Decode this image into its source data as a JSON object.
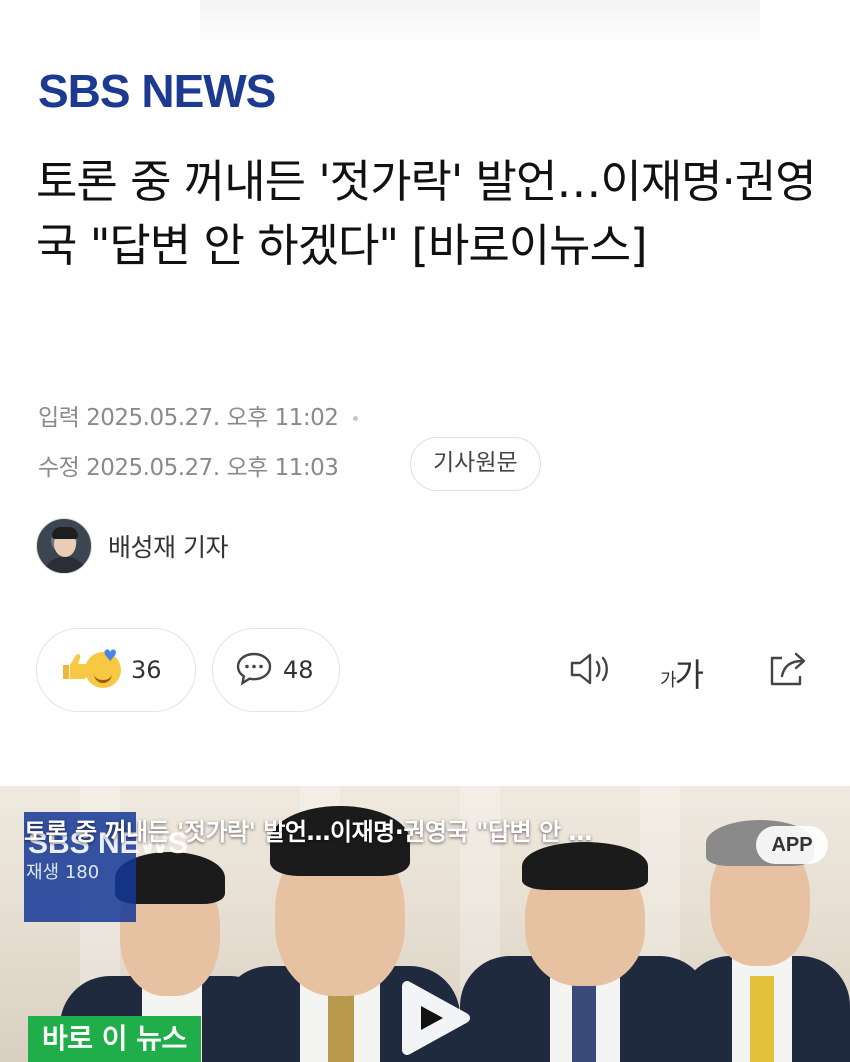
{
  "brand": {
    "logo_text": "SBS NEWS",
    "color": "#1c3a8f"
  },
  "article": {
    "headline": "토론 중 꺼내든 '젓가락' 발언…이재명·권영국 \"답변 안 하겠다\" [바로이뉴스]",
    "published": "입력 2025.05.27. 오후 11:02",
    "modified": "수정 2025.05.27. 오후 11:03",
    "original_button": "기사원문",
    "reporter": "배성재 기자"
  },
  "actions": {
    "reaction_count": "36",
    "comment_count": "48",
    "font_size_label": "가가",
    "sound_icon": "speaker-icon",
    "share_icon": "share-icon"
  },
  "video": {
    "title": "토론 중 꺼내든 '젓가락' 발언…이재명·권영국 \"답변 안 …",
    "badge": "APP",
    "overlay_logo": "SBS NEWS",
    "overlay_sub": "재생 180",
    "caption": "바로 이 뉴스"
  }
}
